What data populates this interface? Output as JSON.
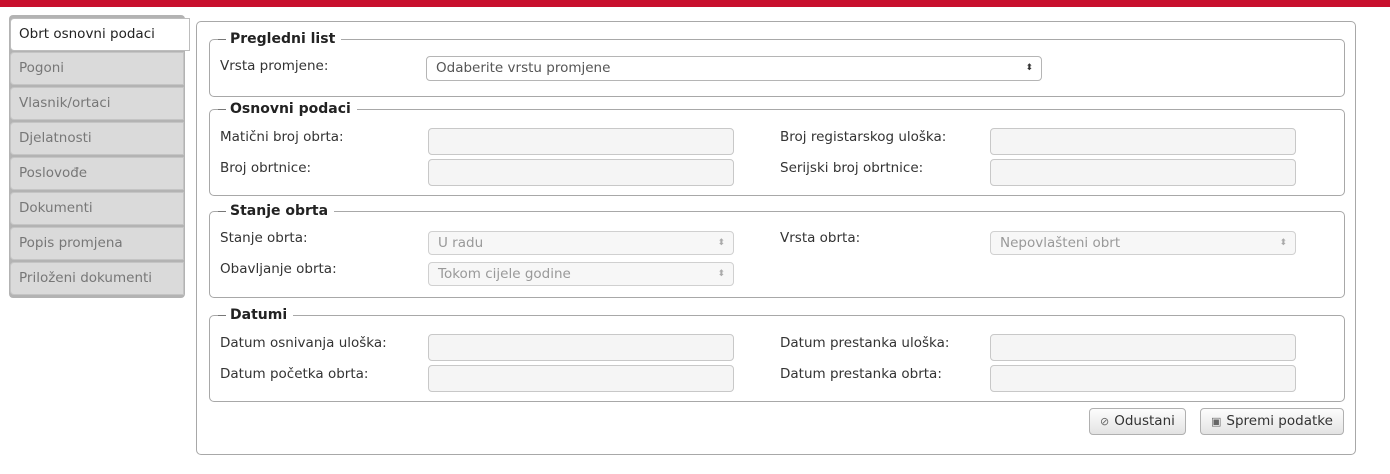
{
  "sidebar": {
    "items": [
      {
        "label": "Obrt osnovni podaci"
      },
      {
        "label": "Pogoni"
      },
      {
        "label": "Vlasnik/ortaci"
      },
      {
        "label": "Djelatnosti"
      },
      {
        "label": "Poslovođe"
      },
      {
        "label": "Dokumenti"
      },
      {
        "label": "Popis promjena"
      },
      {
        "label": "Priloženi dokumenti"
      }
    ],
    "active": "Obrt osnovni podaci"
  },
  "pregledni_list": {
    "legend": "Pregledni list",
    "vrsta_promjene_label": "Vrsta promjene:",
    "vrsta_promjene_value": "Odaberite vrstu promjene"
  },
  "osnovni_podaci": {
    "legend": "Osnovni podaci",
    "maticni_broj_label": "Matični broj obrta:",
    "maticni_broj_value": "",
    "broj_registarskog_label": "Broj registarskog uloška:",
    "broj_registarskog_value": "",
    "broj_obrtnice_label": "Broj obrtnice:",
    "broj_obrtnice_value": "",
    "serijski_broj_label": "Serijski broj obrtnice:",
    "serijski_broj_value": ""
  },
  "stanje_obrta": {
    "legend": "Stanje obrta",
    "stanje_label": "Stanje obrta:",
    "stanje_value": "U radu",
    "vrsta_label": "Vrsta obrta:",
    "vrsta_value": "Nepovlašteni obrt",
    "obavljanje_label": "Obavljanje obrta:",
    "obavljanje_value": "Tokom cijele godine"
  },
  "datumi": {
    "legend": "Datumi",
    "osnivanja_label": "Datum osnivanja uloška:",
    "osnivanja_value": "",
    "prestanka_uloska_label": "Datum prestanka uloška:",
    "prestanka_uloska_value": "",
    "pocetka_label": "Datum početka obrta:",
    "pocetka_value": "",
    "prestanka_obrta_label": "Datum prestanka obrta:",
    "prestanka_obrta_value": ""
  },
  "buttons": {
    "cancel_label": "Odustani",
    "save_label": "Spremi podatke"
  },
  "icons": {
    "select_arrow": "up-down-chevron-icon",
    "cancel": "cancel-circle-icon",
    "save": "floppy-disk-icon"
  },
  "colors": {
    "top_bar": "#c8102e"
  }
}
